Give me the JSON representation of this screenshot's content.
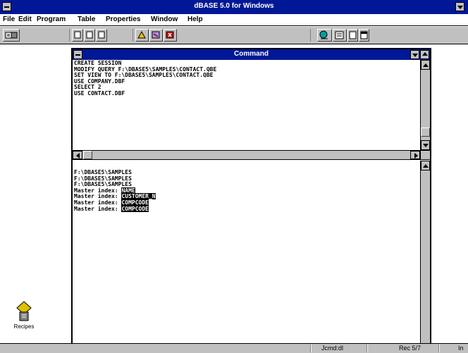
{
  "window": {
    "title": "dBASE 5.0 for Windows"
  },
  "menu": [
    "File",
    "Edit",
    "Program",
    "Table",
    "Properties",
    "Window",
    "Help"
  ],
  "command_window": {
    "title": "Command",
    "commands": [
      "CREATE SESSION",
      "MODIFY QUERY F:\\DBASE5\\SAMPLES\\CONTACT.QBE",
      "SET VIEW TO F:\\DBASE5\\SAMPLES\\CONTACT.QBE",
      "USE COMPANY.DBF",
      "SELECT 2",
      "USE CONTACT.DBF"
    ],
    "results": [
      {
        "text": "F:\\DBASE5\\SAMPLES",
        "highlight": ""
      },
      {
        "text": "F:\\DBASE5\\SAMPLES",
        "highlight": ""
      },
      {
        "text": "F:\\DBASE5\\SAMPLES",
        "highlight": ""
      },
      {
        "text": "Master index: ",
        "highlight": "NAME"
      },
      {
        "text": "Master index: ",
        "highlight": "CUSTOMER_N"
      },
      {
        "text": "Master index: ",
        "highlight": "COMPCODE"
      },
      {
        "text": "Master index: ",
        "highlight": "COMPCODE"
      }
    ]
  },
  "desktop_icon": {
    "label": "Recipes"
  },
  "status": {
    "mode": "Jcmd:dl",
    "record": "Rec 5/7",
    "extra": "In"
  }
}
